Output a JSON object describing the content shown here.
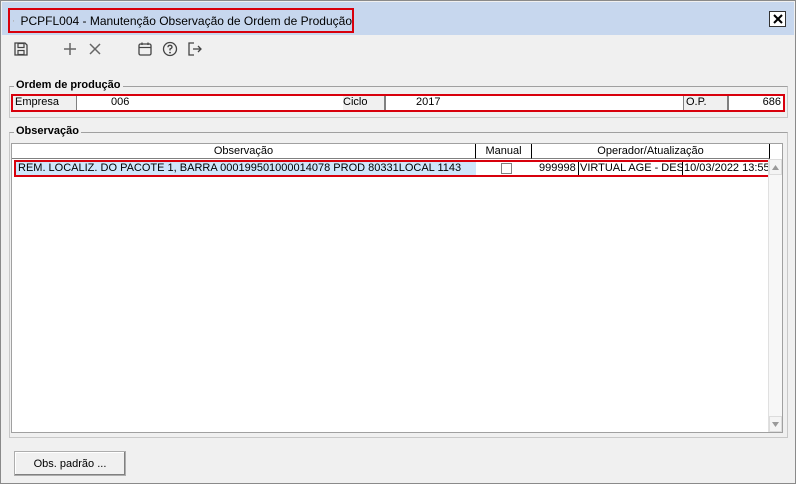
{
  "window": {
    "title": "PCPFL004 - Manutenção Observação de Ordem de Produção"
  },
  "toolbar": {
    "save_icon": "save-icon",
    "add_icon": "plus-icon",
    "delete_icon": "close-icon",
    "calendar_icon": "calendar-icon",
    "help_icon": "help-icon",
    "exit_icon": "exit-icon"
  },
  "ordem": {
    "legend": "Ordem de produção",
    "empresa_label": "Empresa",
    "empresa_value": "006",
    "ciclo_label": "Ciclo",
    "ciclo_value": "2017",
    "op_label": "O.P.",
    "op_value": "686"
  },
  "observacao": {
    "legend": "Observação",
    "columns": [
      "Observação",
      "Manual",
      "Operador/Atualização"
    ],
    "rows": [
      {
        "observacao": "REM. LOCALIZ. DO PACOTE 1, BARRA 000199501000014078 PROD 80331LOCAL 1143",
        "manual": false,
        "operador_codigo": "999998",
        "operador_nome": "VIRTUAL AGE - DESE",
        "atualizacao": "10/03/2022 13:55:"
      }
    ]
  },
  "buttons": {
    "obs_padrao": "Obs. padrão ..."
  },
  "colors": {
    "highlight_border": "#d8000c",
    "title_bar": "#c7d7ee",
    "selected_row": "#cfe6fb"
  }
}
